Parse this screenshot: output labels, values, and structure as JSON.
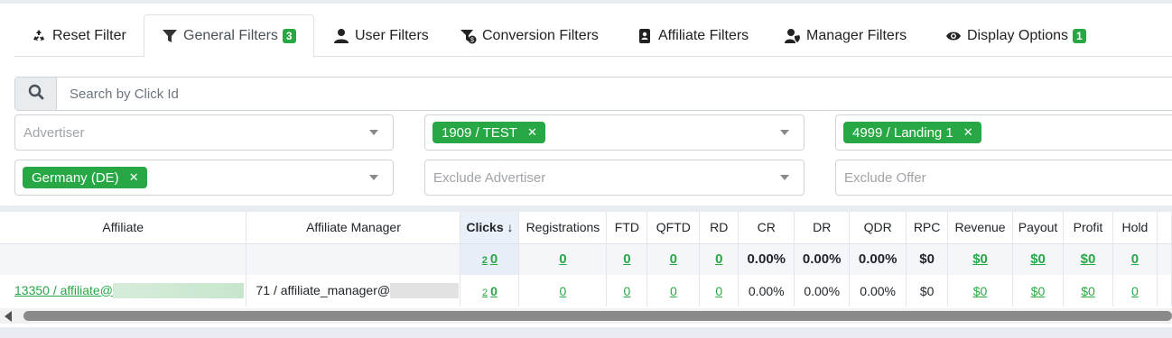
{
  "tabs": [
    {
      "label": "Reset Filter",
      "icon": "recycle-icon"
    },
    {
      "label": "General Filters",
      "icon": "filter-icon",
      "badge": "3",
      "active": true
    },
    {
      "label": "User Filters",
      "icon": "user-icon"
    },
    {
      "label": "Conversion Filters",
      "icon": "funnel-dollar-icon"
    },
    {
      "label": "Affiliate Filters",
      "icon": "address-book-icon"
    },
    {
      "label": "Manager Filters",
      "icon": "user-shield-icon"
    },
    {
      "label": "Display Options",
      "icon": "eye-icon",
      "badge": "1"
    }
  ],
  "search": {
    "placeholder": "Search by Click Id"
  },
  "filters": {
    "advertiser": {
      "placeholder": "Advertiser"
    },
    "offer_selected": {
      "chip": "1909 / TEST"
    },
    "landing_selected": {
      "chip": "4999 / Landing 1"
    },
    "country_selected": {
      "chip": "Germany (DE)"
    },
    "exclude_advertiser": {
      "placeholder": "Exclude Advertiser"
    },
    "exclude_offer": {
      "placeholder": "Exclude Offer"
    }
  },
  "table": {
    "columns": [
      "Affiliate",
      "Affiliate Manager",
      "Clicks ↓",
      "Registrations",
      "FTD",
      "QFTD",
      "RD",
      "CR",
      "DR",
      "QDR",
      "RPC",
      "Revenue",
      "Payout",
      "Profit",
      "Hold"
    ],
    "totals": {
      "clicks_small": "2",
      "clicks": "0",
      "registrations": "0",
      "ftd": "0",
      "qftd": "0",
      "rd": "0",
      "cr": "0.00%",
      "dr": "0.00%",
      "qdr": "0.00%",
      "rpc": "$0",
      "revenue": "$0",
      "payout": "$0",
      "profit": "$0",
      "hold": "0"
    },
    "row": {
      "affiliate": "13350 / affiliate@",
      "manager": "71 / affiliate_manager@",
      "clicks_small": "2",
      "clicks": "0",
      "registrations": "0",
      "ftd": "0",
      "qftd": "0",
      "rd": "0",
      "cr": "0.00%",
      "dr": "0.00%",
      "qdr": "0.00%",
      "rpc": "$0",
      "revenue": "$0",
      "payout": "$0",
      "profit": "$0",
      "hold": "0"
    }
  },
  "colors": {
    "accent_green": "#28a745",
    "sorted_col": "#eaf0f8"
  }
}
